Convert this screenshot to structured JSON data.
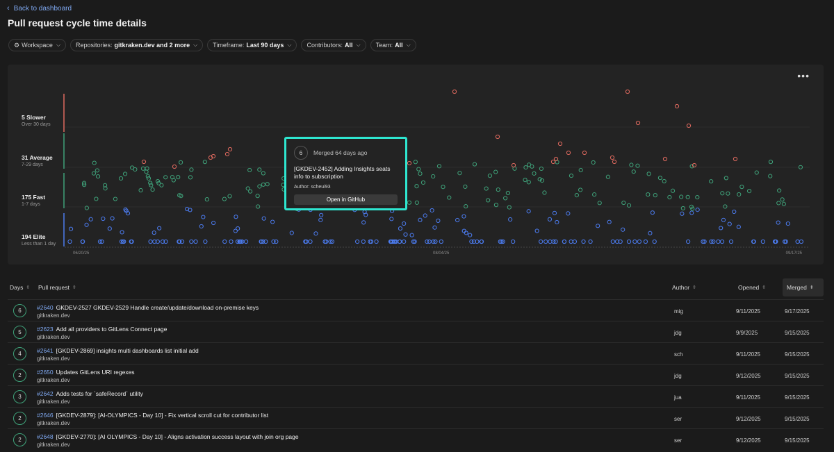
{
  "nav": {
    "back_label": "Back to dashboard"
  },
  "page": {
    "title": "Pull request cycle time details"
  },
  "filters": [
    {
      "label": "Workspace",
      "value": ""
    },
    {
      "label": "Repositories:",
      "value": "gitkraken.dev and 2 more"
    },
    {
      "label": "Timeframe:",
      "value": "Last 90 days"
    },
    {
      "label": "Contributors:",
      "value": "All"
    },
    {
      "label": "Team:",
      "value": "All"
    }
  ],
  "chart_data": {
    "type": "scatter",
    "bands": [
      {
        "name": "Slower",
        "count": "5 Slower",
        "range": "Over 30 days",
        "color": "#e06a5f"
      },
      {
        "name": "Average",
        "count": "31 Average",
        "range": "7-29 days",
        "color": "#3fa27a"
      },
      {
        "name": "Fast",
        "count": "175 Fast",
        "range": "1-7 days",
        "color": "#3fa27a"
      },
      {
        "name": "Elite",
        "count": "194 Elite",
        "range": "Less than 1 day",
        "color": "#4c7cf0"
      }
    ],
    "x_tick_labels": [
      "06/20/25",
      "08/04/25",
      "09/17/25"
    ],
    "colors": {
      "slower": "#e06a5f",
      "average": "#3fa27a",
      "fast": "#3fa27a",
      "elite": "#4c7cf0"
    }
  },
  "tooltip": {
    "days": "6",
    "merged": "Merged 64 days ago",
    "title": "[GKDEV-2452] Adding Insights seats info to subscription",
    "author": "Author: scheui93",
    "button": "Open in GitHub"
  },
  "table": {
    "headers": {
      "days": "Days",
      "pr": "Pull request",
      "author": "Author",
      "opened": "Opened",
      "merged": "Merged"
    },
    "rows": [
      {
        "days": "6",
        "num": "#2640",
        "title": "GKDEV-2527 GKDEV-2529 Handle create/update/download on-premise keys",
        "repo": "gitkraken.dev",
        "author": "mig",
        "opened": "9/11/2025",
        "merged": "9/17/2025"
      },
      {
        "days": "5",
        "num": "#2623",
        "title": "Add all providers to GitLens Connect page",
        "repo": "gitkraken.dev",
        "author": "jdg",
        "opened": "9/9/2025",
        "merged": "9/15/2025"
      },
      {
        "days": "4",
        "num": "#2641",
        "title": "[GKDEV-2869] insights multi dashboards list initial add",
        "repo": "gitkraken.dev",
        "author": "sch",
        "opened": "9/11/2025",
        "merged": "9/15/2025"
      },
      {
        "days": "2",
        "num": "#2650",
        "title": "Updates GitLens URI regexes",
        "repo": "gitkraken.dev",
        "author": "jdg",
        "opened": "9/12/2025",
        "merged": "9/15/2025"
      },
      {
        "days": "3",
        "num": "#2642",
        "title": "Adds tests for `safeRecord` utility",
        "repo": "gitkraken.dev",
        "author": "jua",
        "opened": "9/11/2025",
        "merged": "9/15/2025"
      },
      {
        "days": "2",
        "num": "#2646",
        "title": "[GKDEV-2879]: [AI-OLYMPICS - Day 10] - Fix vertical scroll cut for contributor list",
        "repo": "gitkraken.dev",
        "author": "ser",
        "opened": "9/12/2025",
        "merged": "9/15/2025"
      },
      {
        "days": "2",
        "num": "#2648",
        "title": "[GKDEV-2770]: [AI OLYMPICS - Day 10] - Aligns activation success layout with join org page",
        "repo": "gitkraken.dev",
        "author": "ser",
        "opened": "9/12/2025",
        "merged": "9/15/2025"
      }
    ]
  }
}
